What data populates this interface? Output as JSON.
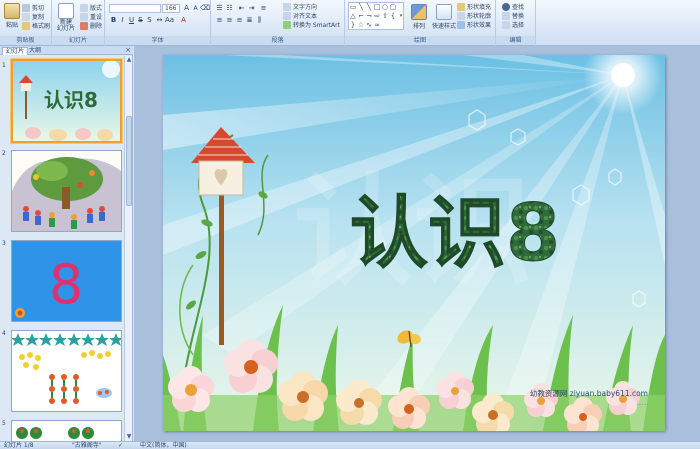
{
  "ribbon": {
    "clipboard": {
      "paste": "粘贴",
      "cut": "剪切",
      "copy": "复制",
      "format_painter": "格式刷",
      "label": "剪贴板"
    },
    "slides": {
      "new_slide": "新建\n幻灯片",
      "layout": "版式",
      "reset": "重设",
      "delete": "删除",
      "label": "幻灯片"
    },
    "font": {
      "font_name": "",
      "font_size": "166",
      "label": "字体"
    },
    "paragraph": {
      "text_direction": "文字方向",
      "align_text": "对齐文本",
      "smartart": "转换为 SmartArt",
      "label": "段落"
    },
    "drawing": {
      "arrange": "排列",
      "quick_styles": "快速样式",
      "shape_fill": "形状填充",
      "shape_outline": "形状轮廓",
      "shape_effects": "形状效果",
      "label": "绘图"
    },
    "editing": {
      "find": "查找",
      "replace": "替换",
      "select": "选择",
      "label": "编辑"
    }
  },
  "panel": {
    "tab_slides": "幻灯片",
    "tab_outline": "大纲",
    "close_glyph": "×",
    "thumb_numbers": [
      "1",
      "2",
      "3",
      "4",
      "5"
    ],
    "thumb1_title": "认识8",
    "thumb3_number": "8"
  },
  "slide": {
    "title": "认识8",
    "watermark_big": "认识",
    "credit_line1": "幼教资源网 ziyuan.baby611.com",
    "credit_line2": "......"
  },
  "status": {
    "slide_counter": "幻灯片 1/8",
    "theme": "\"古雅阁寺\"",
    "language": "中文(简体，中国)"
  },
  "colors": {
    "title_green": "#2f6a3c",
    "sky_top": "#7fcbe8",
    "sky_bottom": "#e7f6e6",
    "thumb3_bg": "#2f93e8",
    "thumb3_digit": "#e2306e"
  }
}
